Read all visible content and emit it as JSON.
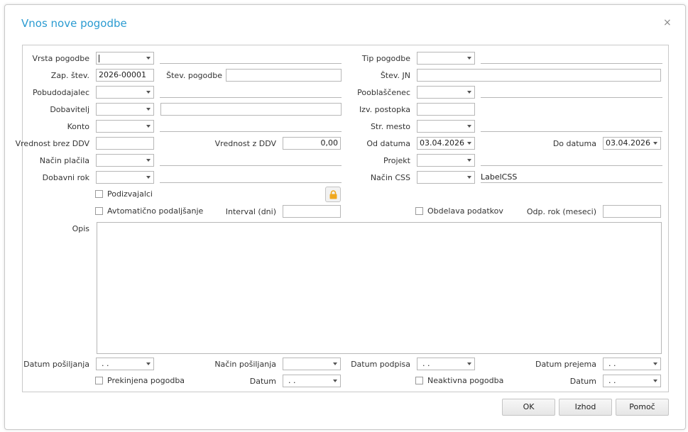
{
  "dialog": {
    "title": "Vnos nove pogodbe",
    "close_glyph": "×"
  },
  "form": {
    "vrsta_pogodbe": {
      "label": "Vrsta pogodbe",
      "value": ""
    },
    "tip_pogodbe": {
      "label": "Tip pogodbe",
      "value": ""
    },
    "zap_stev": {
      "label": "Zap. štev.",
      "value": "2026-00001"
    },
    "stev_pogodbe": {
      "label": "Štev. pogodbe",
      "value": ""
    },
    "stev_jn": {
      "label": "Štev. JN",
      "value": ""
    },
    "pobudodajalec": {
      "label": "Pobudodajalec",
      "value": ""
    },
    "pooblascenec": {
      "label": "Pooblaščenec",
      "value": ""
    },
    "dobavitelj": {
      "label": "Dobavitelj",
      "value": ""
    },
    "izv_postopka": {
      "label": "Izv. postopka",
      "value": ""
    },
    "konto": {
      "label": "Konto",
      "value": ""
    },
    "str_mesto": {
      "label": "Str. mesto",
      "value": ""
    },
    "vrednost_brez_ddv": {
      "label": "Vrednost brez DDV",
      "value": ""
    },
    "vrednost_z_ddv": {
      "label": "Vrednost z DDV",
      "value": "0,00"
    },
    "od_datuma": {
      "label": "Od datuma",
      "value": "03.04.2026"
    },
    "do_datuma": {
      "label": "Do datuma",
      "value": "03.04.2026"
    },
    "nacin_placila": {
      "label": "Način plačila",
      "value": ""
    },
    "projekt": {
      "label": "Projekt",
      "value": ""
    },
    "dobavni_rok": {
      "label": "Dobavni rok",
      "value": ""
    },
    "nacin_css": {
      "label": "Način CSS",
      "value": "",
      "desc": "LabelCSS"
    },
    "podizvajalci": {
      "label": "Podizvajalci",
      "checked": false,
      "lock_icon": "lock-icon"
    },
    "avtomaticno_podaljsanje": {
      "label": "Avtomatično podaljšanje",
      "checked": false
    },
    "interval": {
      "label": "Interval (dni)",
      "value": ""
    },
    "obdelava_podatkov": {
      "label": "Obdelava podatkov",
      "checked": false
    },
    "odp_rok": {
      "label": "Odp. rok (meseci)",
      "value": ""
    },
    "opis": {
      "label": "Opis",
      "value": ""
    },
    "datum_posiljanja": {
      "label": "Datum pošiljanja",
      "value": ". ."
    },
    "nacin_posiljanja": {
      "label": "Način pošiljanja",
      "value": ""
    },
    "datum_podpisa": {
      "label": "Datum podpisa",
      "value": ". ."
    },
    "datum_prejema": {
      "label": "Datum prejema",
      "value": ". ."
    },
    "prekinjena_pogodba": {
      "label": "Prekinjena pogodba",
      "checked": false
    },
    "datum_prekinitve": {
      "label": "Datum",
      "value": ". ."
    },
    "neaktivna_pogodba": {
      "label": "Neaktivna pogodba",
      "checked": false
    },
    "datum_neaktivnosti": {
      "label": "Datum",
      "value": ". ."
    }
  },
  "buttons": {
    "ok": "OK",
    "izhod": "Izhod",
    "pomoc": "Pomoč"
  },
  "colors": {
    "title": "#2b9bd1",
    "lock": "#f0a81e",
    "border": "#c9c9c9"
  }
}
